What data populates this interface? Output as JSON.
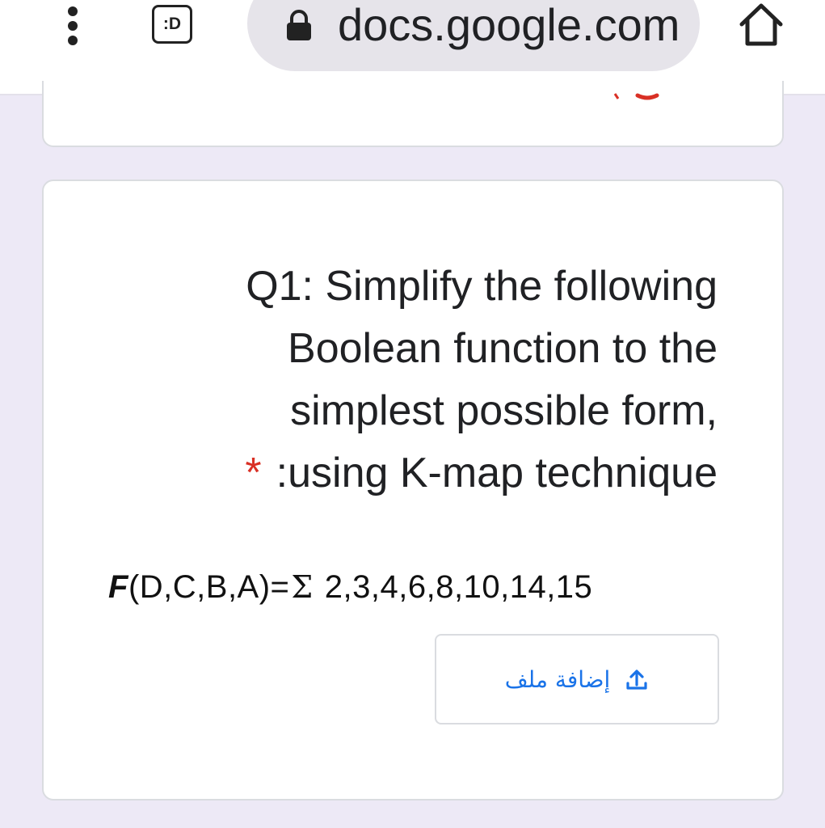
{
  "browser": {
    "url": "docs.google.com",
    "tab_badge": ":D",
    "icons": {
      "menu": "vertical-dots-icon",
      "lock": "lock-icon",
      "home": "home-icon"
    }
  },
  "question": {
    "lines": [
      "Q1: Simplify the following",
      "Boolean function to the",
      "simplest possible form,",
      ":using K-map technique"
    ],
    "required_marker": "*",
    "formula": {
      "function_name": "F",
      "variables": "(D,C,B,A)=",
      "sigma": "Σ",
      "minterms": "2,3,4,6,8,10,14,15"
    }
  },
  "upload": {
    "label": "إضافة ملف",
    "icon": "upload-icon",
    "color": "#1a73e8"
  },
  "colors": {
    "page_background": "#ede9f6",
    "required": "#d93025",
    "card": "#ffffff"
  }
}
